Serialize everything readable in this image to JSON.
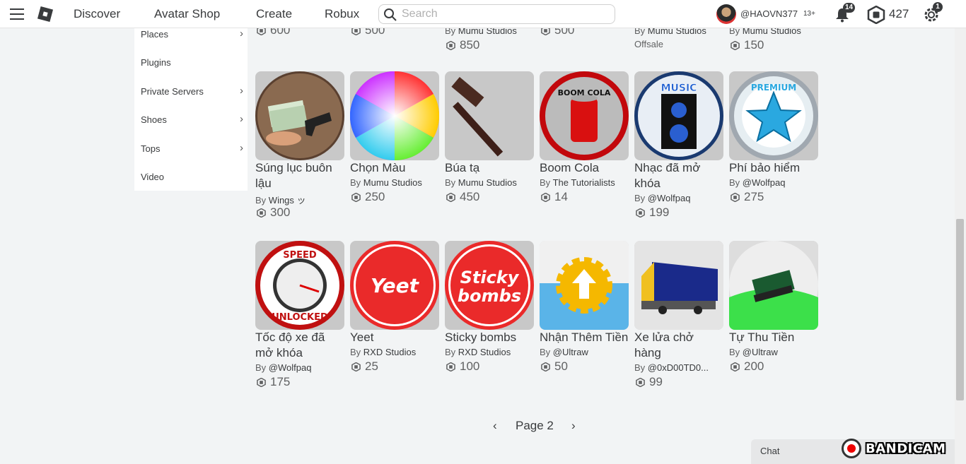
{
  "nav": {
    "links": [
      "Discover",
      "Avatar Shop",
      "Create",
      "Robux"
    ],
    "search_placeholder": "Search",
    "username": "@HAOVN377",
    "age": "13+",
    "notifications": "14",
    "robux": "427",
    "settings_badge": "1"
  },
  "sidebar": {
    "items": [
      {
        "label": "Places",
        "chevron": true
      },
      {
        "label": "Plugins",
        "chevron": false
      },
      {
        "label": "Private Servers",
        "chevron": true
      },
      {
        "label": "Shoes",
        "chevron": true
      },
      {
        "label": "Tops",
        "chevron": true
      },
      {
        "label": "Video",
        "chevron": false
      }
    ]
  },
  "top_row": {
    "prices": [
      "600",
      "500",
      "850",
      "500",
      "",
      "150"
    ],
    "creators": [
      "",
      "",
      "Mumu Studios",
      "",
      "Mumu Studios",
      "Mumu Studios"
    ],
    "offsale": "Offsale"
  },
  "row1": [
    {
      "name": "Súng lục buôn lậu",
      "creator": "Wings ッ",
      "price": "300",
      "art": "money"
    },
    {
      "name": "Chọn Màu",
      "creator": "Mumu Studios",
      "price": "250",
      "art": "wheel"
    },
    {
      "name": "Búa tạ",
      "creator": "Mumu Studios",
      "price": "450",
      "art": "hammer"
    },
    {
      "name": "Boom Cola",
      "creator": "The Tutorialists",
      "price": "14",
      "art": "cola"
    },
    {
      "name": "Nhạc đã mở khóa",
      "creator": "@Wolfpaq",
      "price": "199",
      "art": "music"
    },
    {
      "name": "Phí bảo hiểm",
      "creator": "@Wolfpaq",
      "price": "275",
      "art": "premium"
    }
  ],
  "row2": [
    {
      "name": "Tốc độ xe đã mở khóa",
      "creator": "@Wolfpaq",
      "price": "175",
      "art": "speed"
    },
    {
      "name": "Yeet",
      "creator": "RXD Studios",
      "price": "25",
      "art": "yeet"
    },
    {
      "name": "Sticky bombs",
      "creator": "RXD Studios",
      "price": "100",
      "art": "sticky"
    },
    {
      "name": "Nhận Thêm Tiền",
      "creator": "@Ultraw",
      "price": "50",
      "art": "gear"
    },
    {
      "name": "Xe lửa chở hàng",
      "creator": "@0xD00TD0...",
      "price": "99",
      "art": "train"
    },
    {
      "name": "Tự Thu Tiền",
      "creator": "@Ultraw",
      "price": "200",
      "art": "cash"
    }
  ],
  "art_text": {
    "cola": "BOOM COLA",
    "music": "MUSIC",
    "premium": "PREMIUM",
    "speed_top": "SPEED",
    "speed_bottom": "UNLOCKED",
    "yeet": "Yeet",
    "sticky_1": "Sticky",
    "sticky_2": "bombs"
  },
  "by_label": "By",
  "pager": {
    "label": "Page 2"
  },
  "chat": {
    "label": "Chat"
  },
  "watermark": "BANDICAM",
  "colors": {
    "accent": "#393b3d",
    "thumb_bg": "#c8c8c8",
    "page_bg": "#f2f4f5"
  }
}
